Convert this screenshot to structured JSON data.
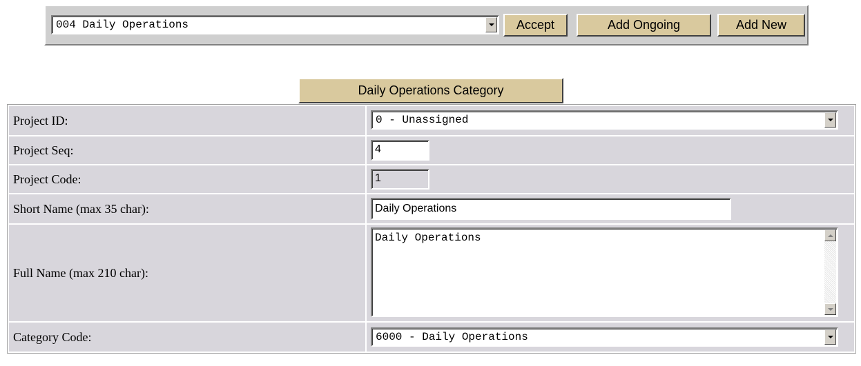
{
  "toolbar": {
    "selector_value": "004 Daily Operations",
    "accept_label": "Accept",
    "add_ongoing_label": "Add Ongoing",
    "add_new_label": "Add New"
  },
  "category_header": "Daily Operations Category",
  "form": {
    "project_id_label": "Project ID:",
    "project_id_value": "0 - Unassigned",
    "project_seq_label": "Project Seq:",
    "project_seq_value": "4",
    "project_code_label": "Project Code:",
    "project_code_value": "1",
    "short_name_label": "Short Name (max 35 char):",
    "short_name_value": "Daily Operations",
    "full_name_label": "Full Name (max 210 char):",
    "full_name_value": "Daily Operations",
    "category_code_label": "Category Code:",
    "category_code_value": "6000 - Daily Operations"
  },
  "colors": {
    "button_bg": "#d9c99e",
    "panel_bg": "#cfcfcf",
    "row_bg": "#d8d6dc"
  }
}
